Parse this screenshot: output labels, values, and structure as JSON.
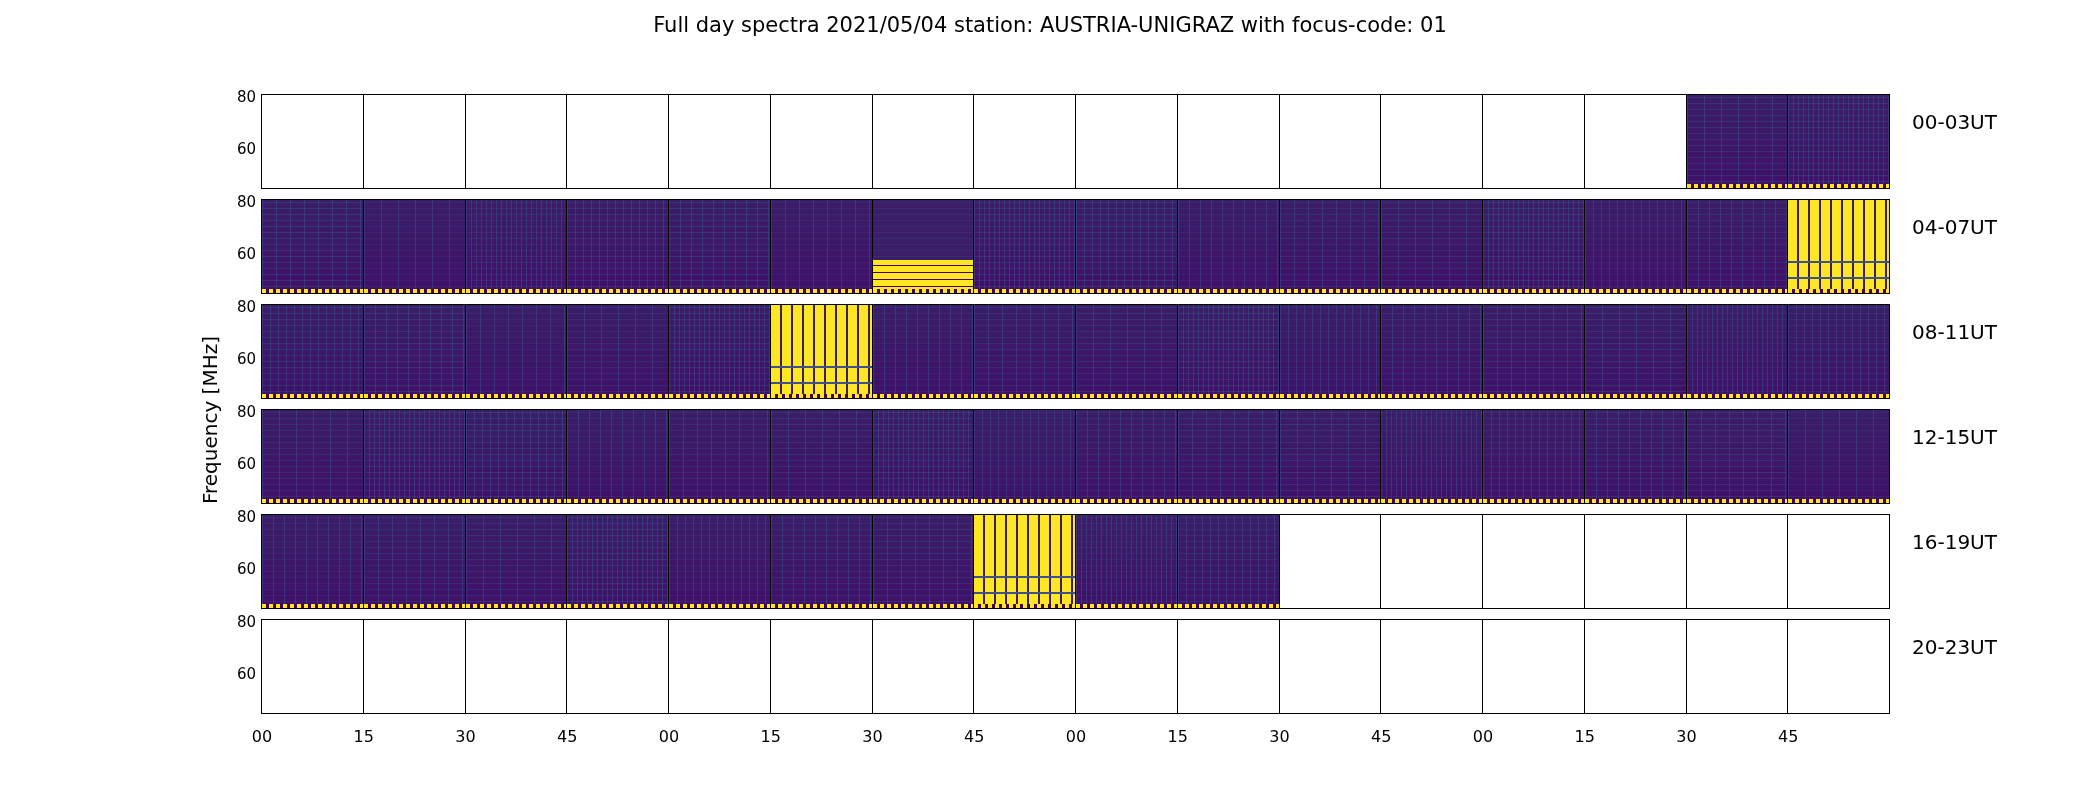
{
  "title": "Full day spectra 2021/05/04 station: AUSTRIA-UNIGRAZ with focus-code: 01",
  "ylabel": "Frequency [MHz]",
  "rows": [
    {
      "label": "00-03UT",
      "yticks": [
        "80",
        "60"
      ],
      "panels": [
        {
          "kind": "empty"
        },
        {
          "kind": "empty"
        },
        {
          "kind": "empty"
        },
        {
          "kind": "empty"
        },
        {
          "kind": "empty"
        },
        {
          "kind": "empty"
        },
        {
          "kind": "empty"
        },
        {
          "kind": "empty"
        },
        {
          "kind": "empty"
        },
        {
          "kind": "empty"
        },
        {
          "kind": "empty"
        },
        {
          "kind": "empty"
        },
        {
          "kind": "empty"
        },
        {
          "kind": "empty"
        },
        {
          "kind": "spectrum"
        },
        {
          "kind": "spectrum"
        }
      ]
    },
    {
      "label": "04-07UT",
      "yticks": [
        "80",
        "60"
      ],
      "panels": [
        {
          "kind": "spectrum"
        },
        {
          "kind": "spectrum"
        },
        {
          "kind": "spectrum"
        },
        {
          "kind": "spectrum"
        },
        {
          "kind": "spectrum"
        },
        {
          "kind": "spectrum"
        },
        {
          "kind": "low-burst"
        },
        {
          "kind": "spectrum"
        },
        {
          "kind": "spectrum"
        },
        {
          "kind": "spectrum"
        },
        {
          "kind": "spectrum"
        },
        {
          "kind": "spectrum"
        },
        {
          "kind": "spectrum"
        },
        {
          "kind": "spectrum"
        },
        {
          "kind": "spectrum"
        },
        {
          "kind": "burst"
        }
      ]
    },
    {
      "label": "08-11UT",
      "yticks": [
        "80",
        "60"
      ],
      "panels": [
        {
          "kind": "spectrum"
        },
        {
          "kind": "spectrum"
        },
        {
          "kind": "spectrum"
        },
        {
          "kind": "spectrum"
        },
        {
          "kind": "spectrum"
        },
        {
          "kind": "burst"
        },
        {
          "kind": "spectrum"
        },
        {
          "kind": "spectrum"
        },
        {
          "kind": "spectrum"
        },
        {
          "kind": "spectrum"
        },
        {
          "kind": "spectrum"
        },
        {
          "kind": "spectrum"
        },
        {
          "kind": "spectrum"
        },
        {
          "kind": "spectrum"
        },
        {
          "kind": "spectrum"
        },
        {
          "kind": "spectrum"
        }
      ]
    },
    {
      "label": "12-15UT",
      "yticks": [
        "80",
        "60"
      ],
      "panels": [
        {
          "kind": "spectrum"
        },
        {
          "kind": "spectrum"
        },
        {
          "kind": "spectrum"
        },
        {
          "kind": "spectrum"
        },
        {
          "kind": "spectrum"
        },
        {
          "kind": "spectrum"
        },
        {
          "kind": "spectrum"
        },
        {
          "kind": "spectrum"
        },
        {
          "kind": "spectrum"
        },
        {
          "kind": "spectrum"
        },
        {
          "kind": "spectrum"
        },
        {
          "kind": "spectrum"
        },
        {
          "kind": "spectrum"
        },
        {
          "kind": "spectrum"
        },
        {
          "kind": "spectrum"
        },
        {
          "kind": "spectrum"
        }
      ]
    },
    {
      "label": "16-19UT",
      "yticks": [
        "80",
        "60"
      ],
      "panels": [
        {
          "kind": "spectrum"
        },
        {
          "kind": "spectrum"
        },
        {
          "kind": "spectrum"
        },
        {
          "kind": "spectrum"
        },
        {
          "kind": "spectrum"
        },
        {
          "kind": "spectrum"
        },
        {
          "kind": "spectrum"
        },
        {
          "kind": "burst"
        },
        {
          "kind": "spectrum"
        },
        {
          "kind": "spectrum"
        },
        {
          "kind": "empty"
        },
        {
          "kind": "empty"
        },
        {
          "kind": "empty"
        },
        {
          "kind": "empty"
        },
        {
          "kind": "empty"
        },
        {
          "kind": "empty"
        }
      ]
    },
    {
      "label": "20-23UT",
      "yticks": [
        "80",
        "60"
      ],
      "panels": [
        {
          "kind": "empty"
        },
        {
          "kind": "empty"
        },
        {
          "kind": "empty"
        },
        {
          "kind": "empty"
        },
        {
          "kind": "empty"
        },
        {
          "kind": "empty"
        },
        {
          "kind": "empty"
        },
        {
          "kind": "empty"
        },
        {
          "kind": "empty"
        },
        {
          "kind": "empty"
        },
        {
          "kind": "empty"
        },
        {
          "kind": "empty"
        },
        {
          "kind": "empty"
        },
        {
          "kind": "empty"
        },
        {
          "kind": "empty"
        },
        {
          "kind": "empty"
        }
      ]
    }
  ],
  "xticks": [
    "00",
    "15",
    "30",
    "45",
    "00",
    "15",
    "30",
    "45",
    "00",
    "15",
    "30",
    "45",
    "00",
    "15",
    "30",
    "45"
  ]
}
